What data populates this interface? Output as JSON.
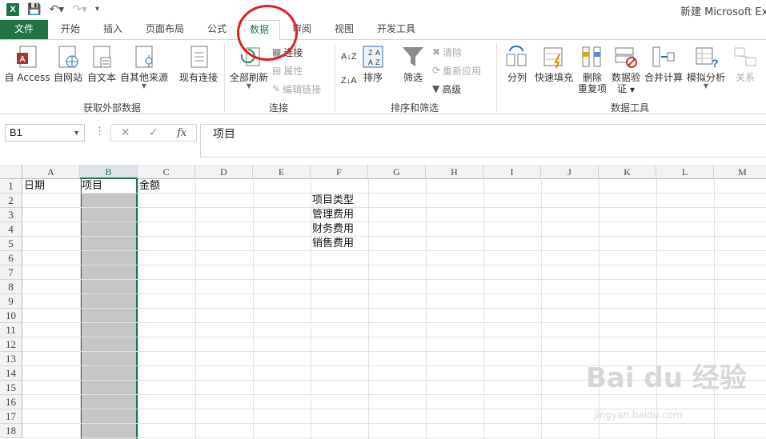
{
  "title": "新建 Microsoft Exc",
  "qat": {
    "app_letter": "X"
  },
  "tabs": {
    "file": "文件",
    "home": "开始",
    "insert": "插入",
    "layout": "页面布局",
    "formulas": "公式",
    "data": "数据",
    "review": "审阅",
    "view": "视图",
    "developer": "开发工具"
  },
  "ribbon": {
    "external": {
      "label": "获取外部数据",
      "access": "自 Access",
      "web": "自网站",
      "text": "自文本",
      "other": "自其他来源",
      "existing": "现有连接"
    },
    "connections": {
      "label": "连接",
      "refresh_all": "全部刷新",
      "connections": "连接",
      "properties": "属性",
      "edit_links": "编辑链接"
    },
    "sort_filter": {
      "label": "排序和筛选",
      "sort": "排序",
      "filter": "筛选",
      "clear": "清除",
      "reapply": "重新应用",
      "advanced": "高级"
    },
    "data_tools": {
      "label": "数据工具",
      "text_to_columns": "分列",
      "flash_fill": "快速填充",
      "remove_dup_1": "删除",
      "remove_dup_2": "重复项",
      "validation_1": "数据验",
      "validation_2": "证",
      "consolidate": "合并计算",
      "what_if": "模拟分析",
      "relationships": "关系"
    }
  },
  "formula_bar": {
    "name_box": "B1",
    "value": "项目",
    "fx": "fx"
  },
  "columns": [
    "A",
    "B",
    "C",
    "D",
    "E",
    "F",
    "G",
    "H",
    "I",
    "J",
    "K",
    "L",
    "M"
  ],
  "rows": [
    "1",
    "2",
    "3",
    "4",
    "5",
    "6",
    "7",
    "8",
    "9",
    "10",
    "11",
    "12",
    "13",
    "14",
    "15",
    "16",
    "17",
    "18"
  ],
  "cells": {
    "A1": "日期",
    "B1": "项目",
    "C1": "金额",
    "F2": "项目类型",
    "F3": "管理费用",
    "F4": "财务费用",
    "F5": "销售费用"
  },
  "watermark": {
    "main": "Bai du 经验",
    "sub": "jingyan.baidu.com"
  },
  "colors": {
    "accent": "#217346",
    "highlight_circle": "#e02020",
    "selection": "#c6c6c6"
  }
}
